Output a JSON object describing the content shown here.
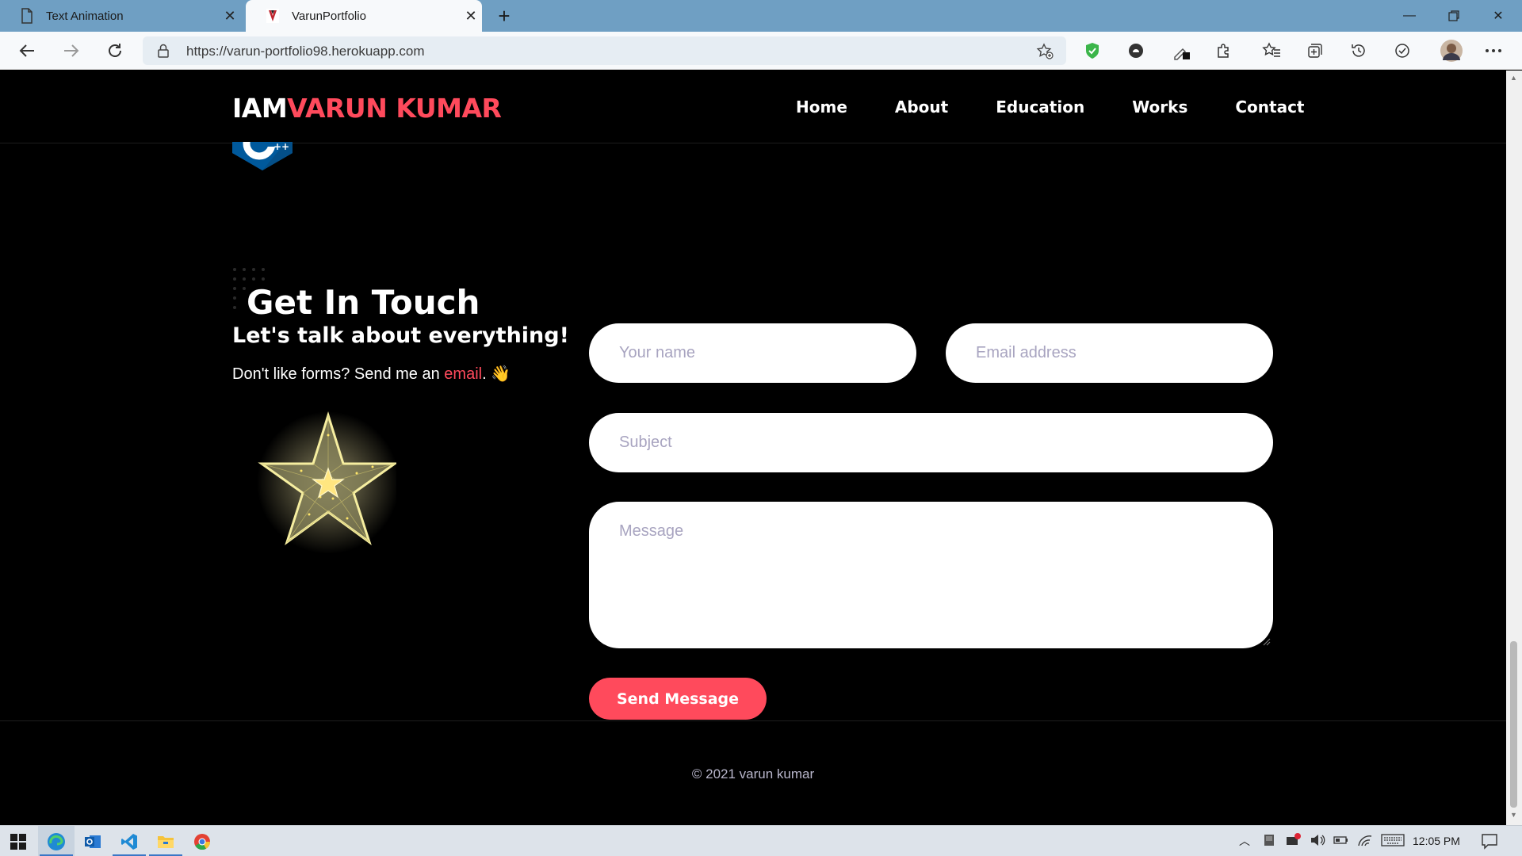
{
  "browser": {
    "tabs": [
      {
        "title": "Text Animation",
        "icon": "page-icon",
        "active": false
      },
      {
        "title": "VarunPortfolio",
        "icon": "site-favicon",
        "active": true
      }
    ],
    "url": "https://varun-portfolio98.herokuapp.com"
  },
  "site": {
    "logo_part1": "IAM",
    "logo_part2": "VARUN KUMAR",
    "nav": [
      "Home",
      "About",
      "Education",
      "Works",
      "Contact"
    ],
    "accent_color": "#ff4a5c"
  },
  "contact": {
    "title": "Get In Touch",
    "subtitle": "Let's talk about everything!",
    "text_before": "Don't like forms? Send me an ",
    "email_link": "email",
    "text_after": ". 👋",
    "name_placeholder": "Your name",
    "email_placeholder": "Email address",
    "subject_placeholder": "Subject",
    "message_placeholder": "Message",
    "send_label": "Send Message"
  },
  "footer": {
    "copyright": "© 2021 varun kumar"
  },
  "taskbar": {
    "time": "12:05 PM"
  }
}
